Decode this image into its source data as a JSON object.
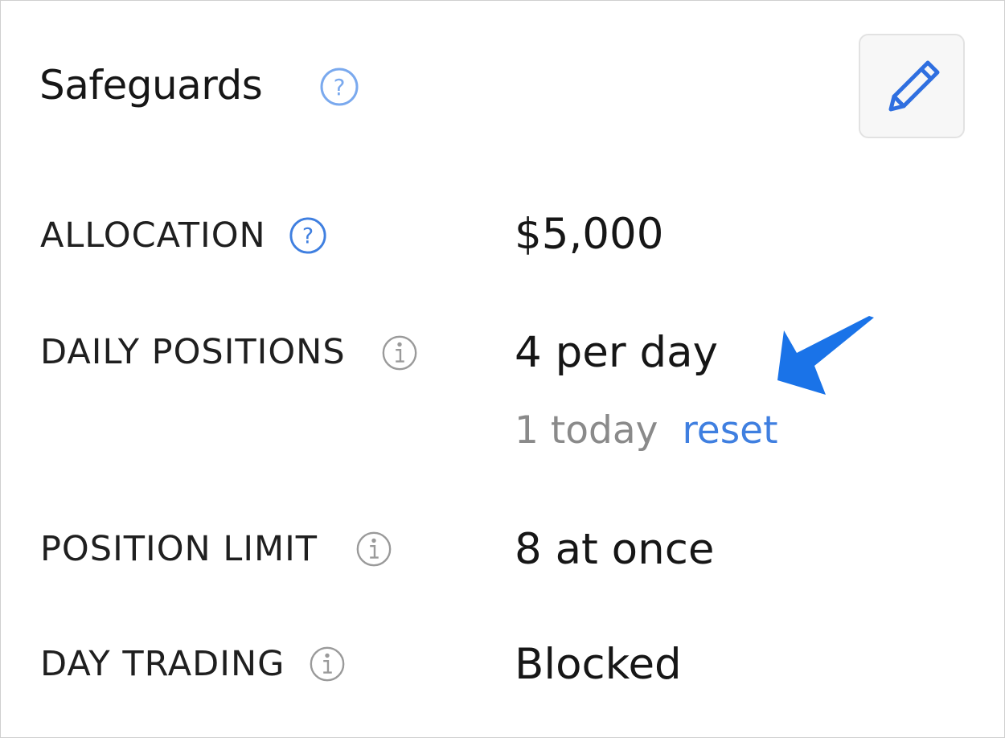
{
  "panel": {
    "title": "Safeguards",
    "help_icon": "question-circle-icon",
    "edit_icon": "pencil-icon"
  },
  "rows": [
    {
      "label": "ALLOCATION",
      "icon": "question-circle-icon",
      "value": "$5,000"
    },
    {
      "label": "DAILY POSITIONS",
      "icon": "info-circle-icon",
      "value": "4 per day",
      "sub": {
        "count_text": "1 today",
        "action_label": "reset"
      }
    },
    {
      "label": "POSITION LIMIT",
      "icon": "info-circle-icon",
      "value": "8 at once"
    },
    {
      "label": "DAY TRADING",
      "icon": "info-circle-icon",
      "value": "Blocked"
    }
  ],
  "annotation": {
    "icon": "arrow-pointer-icon"
  },
  "colors": {
    "accent": "#3f7fe0",
    "arrow": "#1a73e8",
    "muted": "#8a8a8a",
    "info_icon": "#9a9a9a"
  }
}
